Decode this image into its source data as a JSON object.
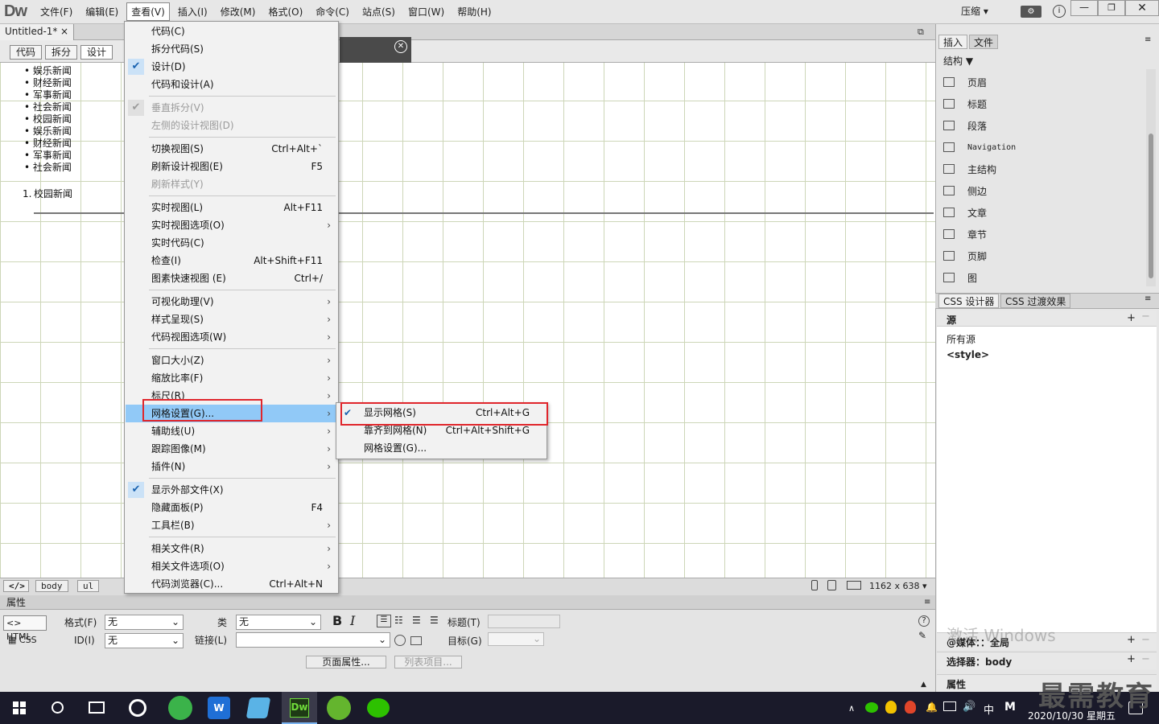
{
  "app": {
    "logo": "Dw",
    "mode": "压缩"
  },
  "menubar": [
    "文件(F)",
    "编辑(E)",
    "查看(V)",
    "插入(I)",
    "修改(M)",
    "格式(O)",
    "命令(C)",
    "站点(S)",
    "窗口(W)",
    "帮助(H)"
  ],
  "document": {
    "tab": "Untitled-1*",
    "close": "×"
  },
  "view_buttons": [
    "代码",
    "拆分",
    "设计"
  ],
  "canvas": {
    "list_items": [
      "娱乐新闻",
      "财经新闻",
      "军事新闻",
      "社会新闻",
      "校园新闻",
      "娱乐新闻",
      "财经新闻",
      "军事新闻",
      "社会新闻"
    ],
    "ordered_num": "1.",
    "ordered_item": "校园新闻"
  },
  "view_menu": [
    {
      "label": "代码(C)"
    },
    {
      "label": "拆分代码(S)"
    },
    {
      "label": "设计(D)",
      "checked": true
    },
    {
      "label": "代码和设计(A)"
    },
    {
      "sep": true
    },
    {
      "label": "垂直拆分(V)",
      "checked": true,
      "disabled": true
    },
    {
      "label": "左侧的设计视图(D)",
      "disabled": true
    },
    {
      "sep": true
    },
    {
      "label": "切换视图(S)",
      "shortcut": "Ctrl+Alt+`"
    },
    {
      "label": "刷新设计视图(E)",
      "shortcut": "F5"
    },
    {
      "label": "刷新样式(Y)",
      "disabled": true
    },
    {
      "sep": true
    },
    {
      "label": "实时视图(L)",
      "shortcut": "Alt+F11"
    },
    {
      "label": "实时视图选项(O)",
      "submenu": true
    },
    {
      "label": "实时代码(C)"
    },
    {
      "label": "检查(I)",
      "shortcut": "Alt+Shift+F11"
    },
    {
      "label": "图素快速视图 (E)",
      "shortcut": "Ctrl+/"
    },
    {
      "sep": true
    },
    {
      "label": "可视化助理(V)",
      "submenu": true
    },
    {
      "label": "样式呈现(S)",
      "submenu": true
    },
    {
      "label": "代码视图选项(W)",
      "submenu": true
    },
    {
      "sep": true
    },
    {
      "label": "窗口大小(Z)",
      "submenu": true
    },
    {
      "label": "缩放比率(F)",
      "submenu": true
    },
    {
      "label": "标尺(R)",
      "submenu": true
    },
    {
      "label": "网格设置(G)...",
      "submenu": true,
      "highlighted": true
    },
    {
      "label": "辅助线(U)",
      "submenu": true
    },
    {
      "label": "跟踪图像(M)",
      "submenu": true
    },
    {
      "label": "插件(N)",
      "submenu": true
    },
    {
      "sep": true
    },
    {
      "label": "显示外部文件(X)",
      "checked": true
    },
    {
      "label": "隐藏面板(P)",
      "shortcut": "F4"
    },
    {
      "label": "工具栏(B)",
      "submenu": true
    },
    {
      "sep": true
    },
    {
      "label": "相关文件(R)",
      "submenu": true
    },
    {
      "label": "相关文件选项(O)",
      "submenu": true
    },
    {
      "label": "代码浏览器(C)...",
      "shortcut": "Ctrl+Alt+N"
    }
  ],
  "grid_submenu": [
    {
      "label": "显示网格(S)",
      "shortcut": "Ctrl+Alt+G",
      "checked": true
    },
    {
      "label": "靠齐到网格(N)",
      "shortcut": "Ctrl+Alt+Shift+G"
    },
    {
      "label": "网格设置(G)..."
    }
  ],
  "status": {
    "tags": [
      "body",
      "ul"
    ],
    "size": "1162 x 638"
  },
  "properties": {
    "title": "属性",
    "html": "HTML",
    "css": "CSS",
    "format_label": "格式(F)",
    "format_value": "无",
    "class_label": "类",
    "class_value": "无",
    "id_label": "ID(I)",
    "id_value": "无",
    "link_label": "链接(L)",
    "title_label": "标题(T)",
    "target_label": "目标(G)",
    "page_props": "页面属性...",
    "list_item": "列表项目..."
  },
  "right_panel": {
    "tabs": [
      "插入",
      "文件"
    ],
    "category": "结构",
    "items": [
      "页眉",
      "标题",
      "段落",
      "Navigation",
      "主结构",
      "侧边",
      "文章",
      "章节",
      "页脚",
      "图"
    ],
    "css_tabs": [
      "CSS 设计器",
      "CSS 过渡效果"
    ],
    "source_header": "源",
    "sources": [
      "所有源",
      "<style>"
    ],
    "media": "@媒体：：全局",
    "selector": "选择器：body",
    "props": "属性"
  },
  "watermark": "激活 Windows",
  "brand": "最需教育",
  "taskbar": {
    "ime": "中",
    "clock_date": "2020/10/30 星期五"
  }
}
